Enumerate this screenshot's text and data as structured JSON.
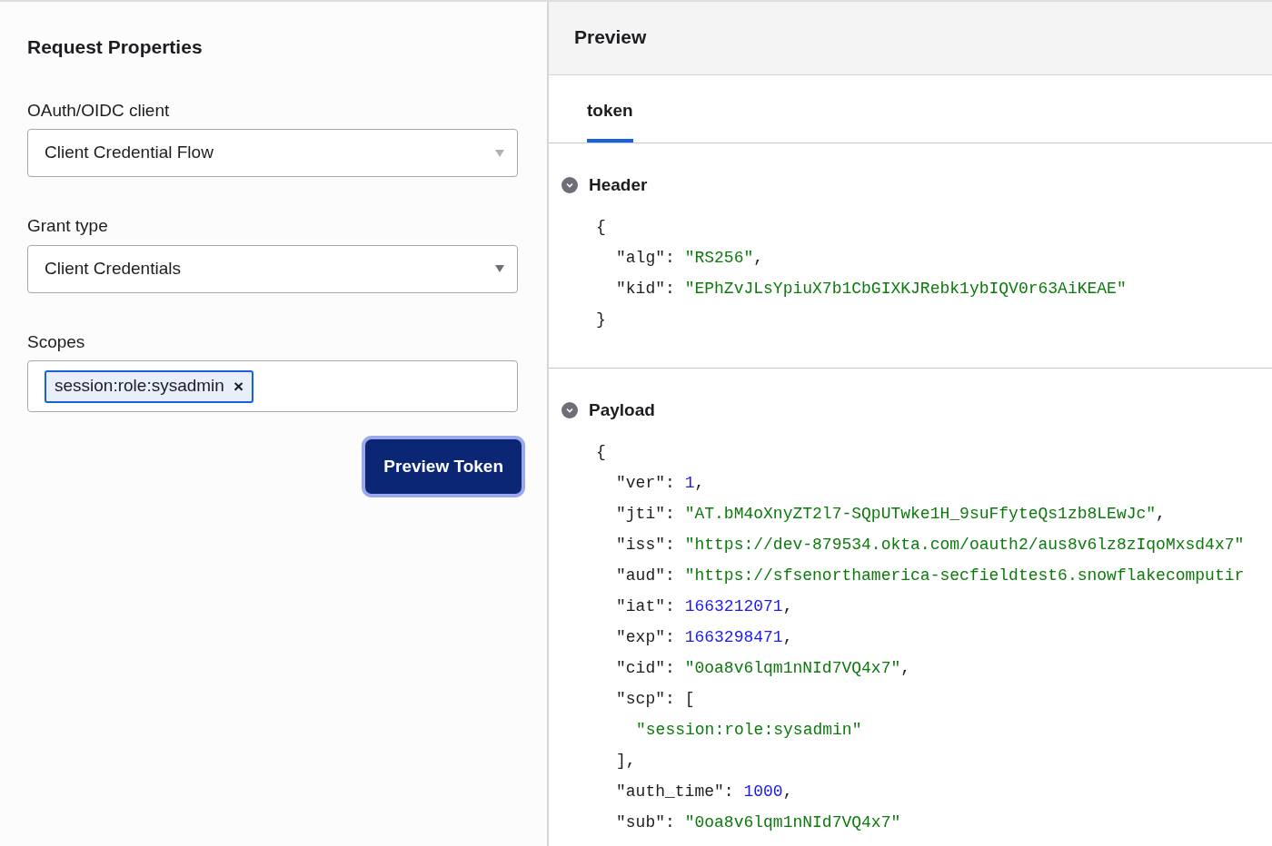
{
  "request_properties": {
    "title": "Request Properties",
    "fields": [
      {
        "kind": "select",
        "label": "OAuth/OIDC client",
        "value": "Client Credential Flow",
        "disabled": true
      },
      {
        "kind": "select",
        "label": "Grant type",
        "value": "Client Credentials",
        "disabled": false
      },
      {
        "kind": "tags",
        "label": "Scopes",
        "tags": [
          {
            "text": "session:role:sysadmin",
            "remove": "×"
          }
        ]
      }
    ],
    "button": "Preview Token"
  },
  "preview": {
    "title": "Preview",
    "tabs": [
      {
        "label": "token",
        "selected": true
      }
    ],
    "sections": [
      {
        "title": "Header",
        "expanded": true,
        "open": "{",
        "close": "}",
        "entries": [
          {
            "key": "\"alg\":",
            "value": "\"RS256\"",
            "kind": "string",
            "suffix": ","
          },
          {
            "key": "\"kid\":",
            "value": "\"EPhZvJLsYpiuX7b1CbGIXKJRebk1ybIQV0r63AiKEAE\"",
            "kind": "string"
          }
        ]
      },
      {
        "title": "Payload",
        "expanded": true,
        "open": "{",
        "entries": [
          {
            "key": "\"ver\":",
            "value": "1",
            "kind": "number",
            "suffix": ","
          },
          {
            "key": "\"jti\":",
            "value": "\"AT.bM4oXnyZT2l7-SQpUTwke1H_9suFfyteQs1zb8LEwJc\"",
            "kind": "string",
            "suffix": ","
          },
          {
            "key": "\"iss\":",
            "value": "\"https://dev-879534.okta.com/oauth2/aus8v6lz8zIqoMxsd4x7\"",
            "kind": "string"
          },
          {
            "key": "\"aud\":",
            "value": "\"https://sfsenorthamerica-secfieldtest6.snowflakecomputir",
            "kind": "string"
          },
          {
            "key": "\"iat\":",
            "value": "1663212071",
            "kind": "number",
            "suffix": ","
          },
          {
            "key": "\"exp\":",
            "value": "1663298471",
            "kind": "number",
            "suffix": ","
          },
          {
            "key": "\"cid\":",
            "value": "\"0oa8v6lqm1nNId7VQ4x7\"",
            "kind": "string",
            "suffix": ","
          },
          {
            "key": "\"scp\":",
            "open": "[",
            "children": [
              {
                "value": "\"session:role:sysadmin\"",
                "kind": "string"
              }
            ],
            "close": "],"
          },
          {
            "key": "\"auth_time\":",
            "value": "1000",
            "kind": "number",
            "suffix": ","
          },
          {
            "key": "\"sub\":",
            "value": "\"0oa8v6lqm1nNId7VQ4x7\"",
            "kind": "string"
          }
        ]
      }
    ]
  }
}
